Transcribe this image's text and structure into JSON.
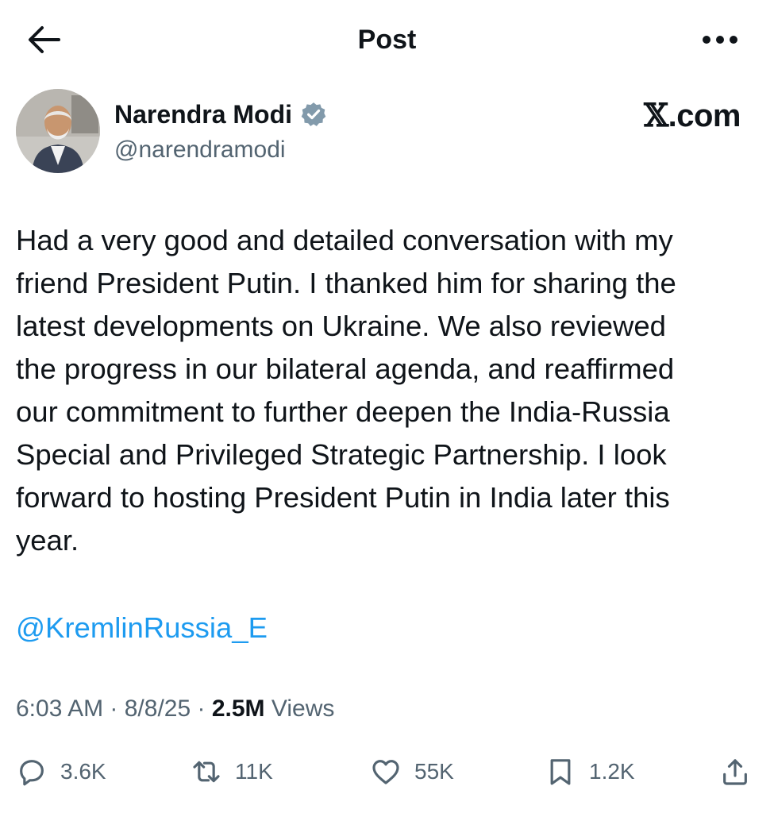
{
  "header": {
    "title": "Post",
    "back_icon": "arrow-left-icon",
    "more_icon": "more-horizontal-icon"
  },
  "author": {
    "name": "Narendra Modi",
    "handle": "@narendramodi",
    "verified_icon": "verified-badge-icon",
    "verified_color": "#829aab"
  },
  "brand": {
    "x_glyph": "𝕏",
    "suffix": ".com"
  },
  "post": {
    "text": "Had a very good and detailed conversation with my\nfriend President Putin. I thanked him for sharing the\nlatest developments on Ukraine. We also reviewed\nthe progress in our bilateral agenda, and reaffirmed\nour commitment to further deepen the India-Russia\nSpecial and Privileged Strategic Partnership. I look\nforward to hosting President Putin in India later this\nyear.",
    "mention": "@KremlinRussia_E",
    "mention_color": "#1d9bf0"
  },
  "meta": {
    "time": "6:03 AM",
    "date": "8/8/25",
    "views_count": "2.5M",
    "views_label": "Views"
  },
  "actions": {
    "replies": "3.6K",
    "reposts": "11K",
    "likes": "55K",
    "bookmarks": "1.2K"
  }
}
